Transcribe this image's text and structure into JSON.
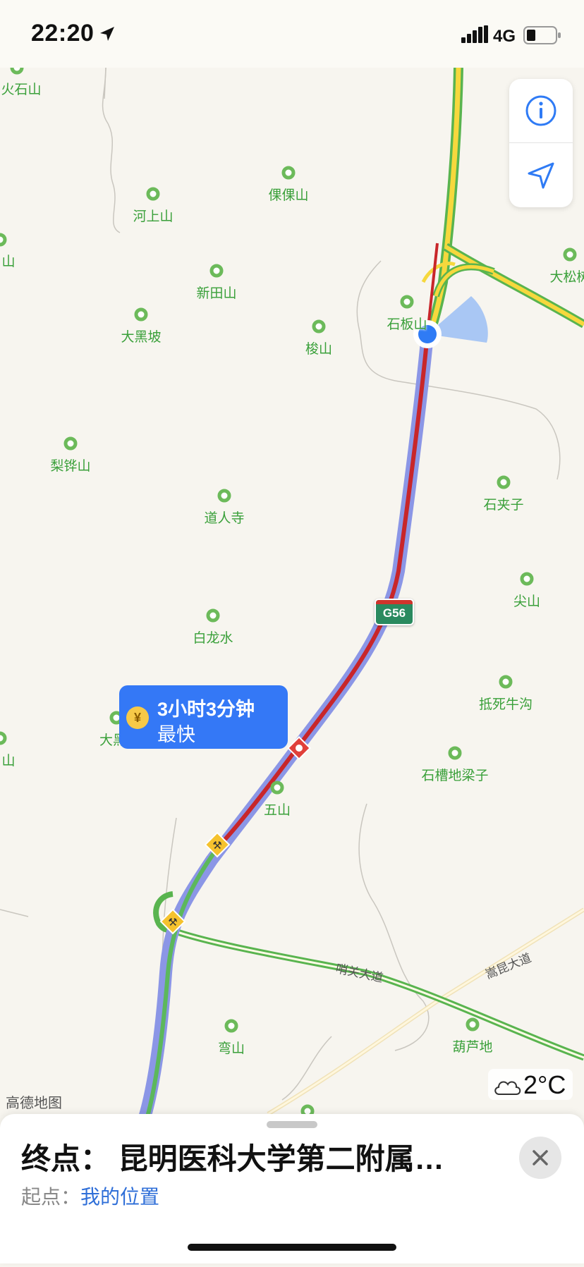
{
  "status_bar": {
    "time": "22:20",
    "network": "4G",
    "icons": [
      "location-arrow-icon",
      "signal-icon",
      "battery-icon"
    ]
  },
  "map": {
    "labels": [
      "火石山",
      "河上山",
      "倮倮山",
      "新田山",
      "大黑坡",
      "梭山",
      "石板山",
      "大松树",
      "梨铧山",
      "道人寺",
      "石夹子",
      "尖山",
      "白龙水",
      "抵死牛沟",
      "大黑",
      "石槽地梁子",
      "五山",
      "弯山",
      "葫芦地",
      "山",
      "山",
      "山"
    ],
    "road_labels": [
      "哨关大道",
      "嵩昆大道"
    ],
    "highway_shield": "G56",
    "attribution": "高德地图",
    "weather": {
      "icon": "cloud-icon",
      "temperature": "2°C"
    },
    "colors": {
      "route": "#c8262a",
      "route_outline": "#7f8fe0",
      "smooth_traffic": "#5cb85c",
      "slow_traffic": "#f5d33b",
      "user_location": "#2f7bf5"
    }
  },
  "route_callout": {
    "duration": "3小时3分钟",
    "tag": "最快",
    "icon": "yen-icon"
  },
  "map_controls": {
    "info_icon": "info-icon",
    "locate_icon": "navigation-arrow-icon"
  },
  "bottom_sheet": {
    "destination": "终点：  昆明医科大学第二附属…",
    "origin_label": "起点：",
    "origin_value": "我的位置",
    "close_icon": "close-icon"
  }
}
